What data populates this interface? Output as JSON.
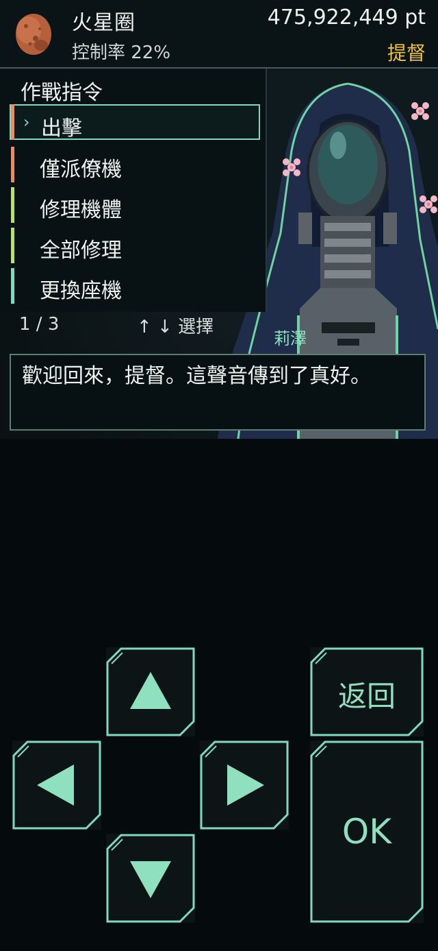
{
  "header": {
    "location_name": "火星圈",
    "control_rate": "控制率 22%",
    "points": "475,922,449 pt",
    "rank": "提督",
    "planet_icon": "mars-planet-icon"
  },
  "menu": {
    "title": "作戰指令",
    "cursor": "›",
    "items": [
      {
        "label": "出擊",
        "color": "#f08c5a",
        "selected": true
      },
      {
        "label": "僅派僚機",
        "color": "#f08c5a"
      },
      {
        "label": "修理機體",
        "color": "#b6e36b"
      },
      {
        "label": "全部修理",
        "color": "#b6e36b"
      },
      {
        "label": "更換座機",
        "color": "#7fd9bb"
      }
    ],
    "page": "1 / 3",
    "hint": "↑ ↓ 選擇"
  },
  "speaker": "莉澤",
  "dialog": {
    "text": "歡迎回來，提督。這聲音傳到了真好。"
  },
  "controls": {
    "up_icon": "triangle-up-icon",
    "down_icon": "triangle-down-icon",
    "left_icon": "triangle-left-icon",
    "right_icon": "triangle-right-icon",
    "back_label": "返回",
    "ok_label": "OK"
  },
  "colors": {
    "accent": "#7fd9bb",
    "gold": "#f0c233",
    "background": "#050b0c"
  }
}
